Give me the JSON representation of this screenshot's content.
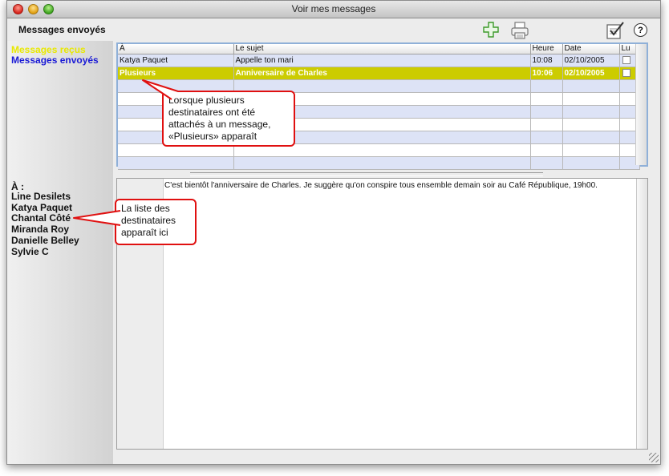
{
  "window": {
    "title": "Voir mes messages"
  },
  "header": {
    "section_label": "Messages envoyés"
  },
  "toolbar": {
    "add_icon": "plus-icon",
    "print_icon": "printer-icon",
    "edit_icon": "checklist-icon",
    "help_label": "?"
  },
  "sidebar": {
    "items": [
      {
        "label": "Messages reçus",
        "color": "#e8e800"
      },
      {
        "label": "Messages envoyés",
        "color": "#1a1ad6"
      }
    ],
    "recipients_label": "À :",
    "recipients": [
      "Line Desilets",
      "Katya Paquet",
      "Chantal Côté",
      "Miranda Roy",
      "Danielle Belley",
      "Sylvie C"
    ]
  },
  "table": {
    "columns": [
      "À",
      "Le sujet",
      "Heure",
      "Date",
      "Lu"
    ],
    "rows": [
      {
        "to": "Katya Paquet",
        "subject": "Appelle ton mari",
        "time": "10:08",
        "date": "02/10/2005",
        "read": false
      },
      {
        "to": "Plusieurs",
        "subject": "Anniversaire de Charles",
        "time": "10:06",
        "date": "02/10/2005",
        "read": false,
        "selected": true
      }
    ],
    "selected_color": "#cccc00"
  },
  "message": {
    "body": "C'est bientôt l'anniversaire de Charles. Je suggère qu'on conspire tous ensemble demain soir au Café République, 19h00."
  },
  "callouts": {
    "plusieurs": [
      "Lorsque plusieurs",
      "destinataires ont été",
      "attachés à un message,",
      "«Plusieurs» apparaît"
    ],
    "recipients": [
      "La liste des",
      "destinataires",
      "apparaît ici"
    ],
    "border_color": "#e01010"
  }
}
